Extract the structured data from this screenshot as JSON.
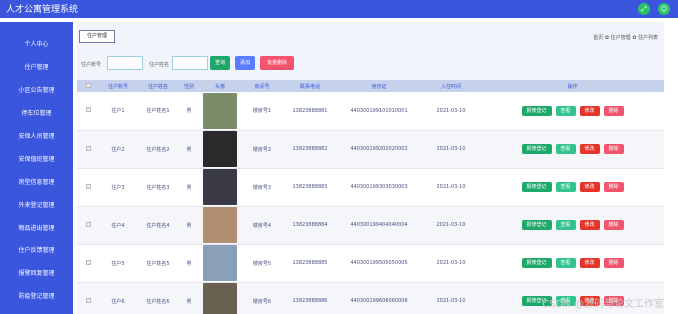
{
  "header": {
    "title": "人才公寓管理系统",
    "icons": [
      "expand-icon",
      "user-icon"
    ]
  },
  "sidebar": {
    "items": [
      {
        "label": "个人中心"
      },
      {
        "label": "住户管理"
      },
      {
        "label": "小区公告管理"
      },
      {
        "label": "停车位管理"
      },
      {
        "label": "安保人员管理"
      },
      {
        "label": "安保值班管理"
      },
      {
        "label": "房型信息管理"
      },
      {
        "label": "外来登记管理"
      },
      {
        "label": "物品进出管理"
      },
      {
        "label": "住户反馈管理"
      },
      {
        "label": "报警回复管理"
      },
      {
        "label": "防疫登记管理"
      }
    ]
  },
  "main": {
    "tab_label": "住户管理",
    "breadcrumb": "首页 ✿ 住户管理 ✿ 住户列表",
    "search": {
      "field1_label": "住户账号",
      "field2_label": "住户姓名",
      "search_btn": "查询",
      "add_btn": "添加",
      "batch_delete_btn": "批量删除"
    },
    "columns": [
      "",
      "住户账号",
      "住户姓名",
      "性别",
      "头像",
      "房间号",
      "联系电话",
      "身份证",
      "入住时间",
      "操作"
    ],
    "rows": [
      {
        "account": "住户1",
        "name": "住户姓名1",
        "gender": "男",
        "room": "楼房号1",
        "phone": "13823888881",
        "id": "440300199101010001",
        "date": "2021-03-10",
        "avatar_color": "#7a8c6a"
      },
      {
        "account": "住户2",
        "name": "住户姓名2",
        "gender": "男",
        "room": "楼房号2",
        "phone": "13823888882",
        "id": "440300199202020002",
        "date": "2021-03-10",
        "avatar_color": "#2a2a2a"
      },
      {
        "account": "住户3",
        "name": "住户姓名3",
        "gender": "男",
        "room": "楼房号3",
        "phone": "13823888883",
        "id": "440300199303030003",
        "date": "2021-03-10",
        "avatar_color": "#3a3a44"
      },
      {
        "account": "住户4",
        "name": "住户姓名4",
        "gender": "男",
        "room": "楼房号4",
        "phone": "13823888884",
        "id": "440300199404040004",
        "date": "2021-03-10",
        "avatar_color": "#b09070"
      },
      {
        "account": "住户5",
        "name": "住户姓名5",
        "gender": "男",
        "room": "楼房号5",
        "phone": "13823888885",
        "id": "440300199505050005",
        "date": "2021-03-10",
        "avatar_color": "#8aa0b8"
      },
      {
        "account": "住户6",
        "name": "住户姓名6",
        "gender": "男",
        "room": "楼房号6",
        "phone": "13823888886",
        "id": "440300199606060006",
        "date": "2021-03-10",
        "avatar_color": "#6a6050"
      }
    ],
    "ops": {
      "register": "报修登记",
      "view": "查看",
      "edit": "修改",
      "delete": "删除"
    }
  },
  "watermark": "CSDN @源码与论文工作室",
  "colors": {
    "primary": "#3a56dc",
    "green": "#1ea96a",
    "teal": "#34c38f",
    "red": "#e5352b",
    "pink": "#f2536d",
    "blue": "#5a7dff"
  }
}
